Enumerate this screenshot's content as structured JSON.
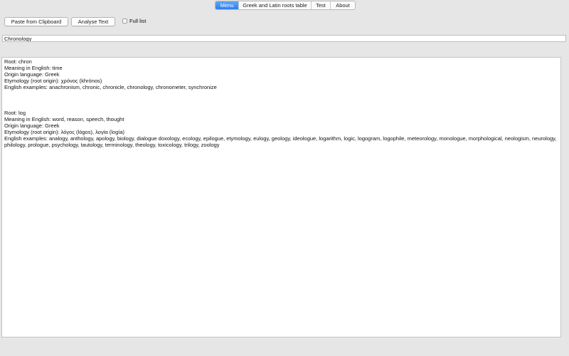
{
  "tabs": [
    {
      "label": "Menu",
      "active": true
    },
    {
      "label": "Greek and Latin roots table",
      "active": false
    },
    {
      "label": "Test",
      "active": false
    },
    {
      "label": "About",
      "active": false
    }
  ],
  "toolbar": {
    "paste_label": "Paste from Clipboard",
    "analyse_label": "Analyse Text",
    "full_list_label": "Full list",
    "full_list_checked": false
  },
  "search": {
    "value": "Chronology"
  },
  "results": [
    {
      "root": "Root: chron",
      "meaning": "Meaning in English: time",
      "origin": "Origin language: Greek",
      "etymology": "Etymology (root origin): χρόνος (khrónos)",
      "examples": "English examples: anachronism, chronic, chronicle, chronology, chronometer, synchronize"
    },
    {
      "root": "Root: log",
      "meaning": "Meaning in English: word, reason, speech, thought",
      "origin": "Origin language: Greek",
      "etymology": "Etymology (root origin): λόγος (lógos), λογία (logía)",
      "examples": "English examples: analogy, anthology, apology, biology, dialogue doxology, ecology, epilogue, etymology, eulogy, geology, ideologue, logarithm, logic, logogram, logophile, meteorology, monologue, morphological, neologism, neurology, philology, prologue, psychology, tautology, terminology, theology, toxicology, trilogy, zoology"
    }
  ]
}
